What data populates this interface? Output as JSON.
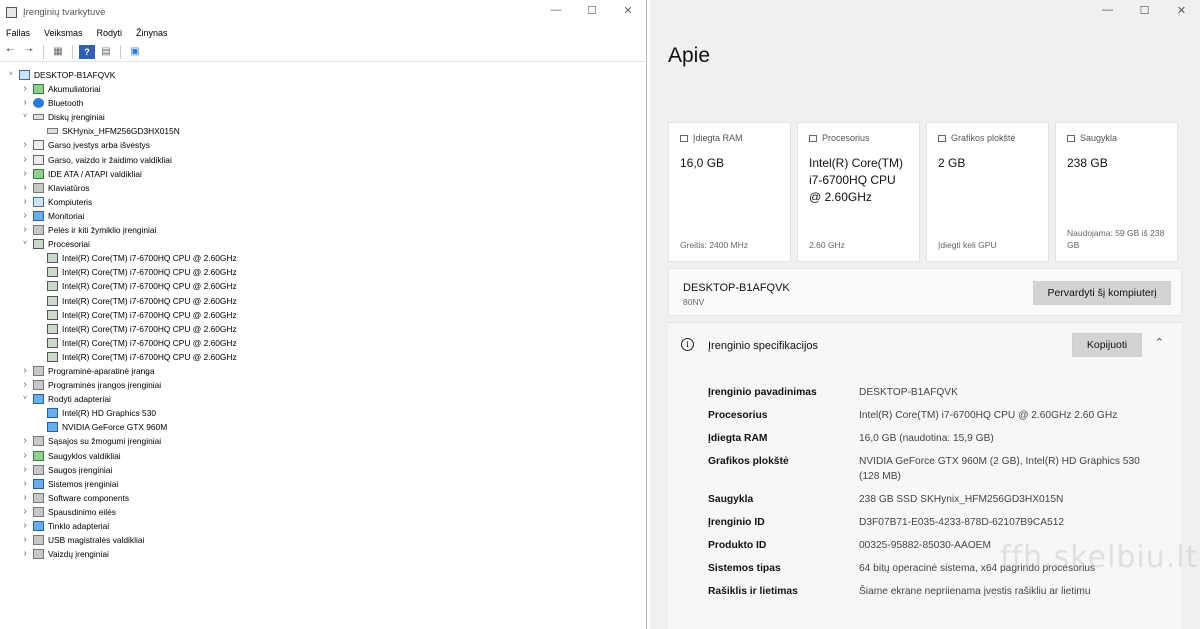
{
  "device_manager": {
    "title": "Įrenginių tvarkytuvė",
    "menu": [
      "Failas",
      "Veiksmas",
      "Rodyti",
      "Žinynas"
    ],
    "toolbar_icons": [
      "back-arrow-icon",
      "forward-arrow-icon",
      "properties-icon",
      "help-icon",
      "view-icon",
      "monitor-icon"
    ],
    "tree": [
      {
        "label": "DESKTOP-B1AFQVK",
        "level": 0,
        "state": "expanded",
        "icon": "computer-icon"
      },
      {
        "label": "Akumuliatoriai",
        "level": 1,
        "state": "collapsed",
        "icon": "battery-icon"
      },
      {
        "label": "Bluetooth",
        "level": 1,
        "state": "collapsed",
        "icon": "bluetooth-icon"
      },
      {
        "label": "Diskų įrenginiai",
        "level": 1,
        "state": "expanded",
        "icon": "disk-icon"
      },
      {
        "label": "SKHynix_HFM256GD3HX015N",
        "level": 2,
        "state": "leaf",
        "icon": "disk-icon"
      },
      {
        "label": "Garso įvestys arba išvestys",
        "level": 1,
        "state": "collapsed",
        "icon": "speaker-icon"
      },
      {
        "label": "Garso, vaizdo ir žaidimo valdikliai",
        "level": 1,
        "state": "collapsed",
        "icon": "speaker-icon"
      },
      {
        "label": "IDE ATA / ATAPI valdikliai",
        "level": 1,
        "state": "collapsed",
        "icon": "controller-icon"
      },
      {
        "label": "Klaviatūros",
        "level": 1,
        "state": "collapsed",
        "icon": "keyboard-icon"
      },
      {
        "label": "Kompiuteris",
        "level": 1,
        "state": "collapsed",
        "icon": "computer-icon"
      },
      {
        "label": "Monitoriai",
        "level": 1,
        "state": "collapsed",
        "icon": "monitor-icon"
      },
      {
        "label": "Pelės ir kiti žymiklio įrenginiai",
        "level": 1,
        "state": "collapsed",
        "icon": "mouse-icon"
      },
      {
        "label": "Procesoriai",
        "level": 1,
        "state": "expanded",
        "icon": "processor-icon"
      },
      {
        "label": "Intel(R) Core(TM) i7-6700HQ CPU @ 2.60GHz",
        "level": 2,
        "state": "leaf",
        "icon": "processor-icon"
      },
      {
        "label": "Intel(R) Core(TM) i7-6700HQ CPU @ 2.60GHz",
        "level": 2,
        "state": "leaf",
        "icon": "processor-icon"
      },
      {
        "label": "Intel(R) Core(TM) i7-6700HQ CPU @ 2.60GHz",
        "level": 2,
        "state": "leaf",
        "icon": "processor-icon"
      },
      {
        "label": "Intel(R) Core(TM) i7-6700HQ CPU @ 2.60GHz",
        "level": 2,
        "state": "leaf",
        "icon": "processor-icon"
      },
      {
        "label": "Intel(R) Core(TM) i7-6700HQ CPU @ 2.60GHz",
        "level": 2,
        "state": "leaf",
        "icon": "processor-icon"
      },
      {
        "label": "Intel(R) Core(TM) i7-6700HQ CPU @ 2.60GHz",
        "level": 2,
        "state": "leaf",
        "icon": "processor-icon"
      },
      {
        "label": "Intel(R) Core(TM) i7-6700HQ CPU @ 2.60GHz",
        "level": 2,
        "state": "leaf",
        "icon": "processor-icon"
      },
      {
        "label": "Intel(R) Core(TM) i7-6700HQ CPU @ 2.60GHz",
        "level": 2,
        "state": "leaf",
        "icon": "processor-icon"
      },
      {
        "label": "Programinė-aparatinė įranga",
        "level": 1,
        "state": "collapsed",
        "icon": "firmware-icon"
      },
      {
        "label": "Programinės įrangos įrenginiai",
        "level": 1,
        "state": "collapsed",
        "icon": "software-device-icon"
      },
      {
        "label": "Rodyti adapteriai",
        "level": 1,
        "state": "expanded",
        "icon": "display-adapter-icon"
      },
      {
        "label": "Intel(R) HD Graphics 530",
        "level": 2,
        "state": "leaf",
        "icon": "display-adapter-icon"
      },
      {
        "label": "NVIDIA GeForce GTX 960M",
        "level": 2,
        "state": "leaf",
        "icon": "display-adapter-icon"
      },
      {
        "label": "Sąsajos su žmogumi įrenginiai",
        "level": 1,
        "state": "collapsed",
        "icon": "hid-icon"
      },
      {
        "label": "Saugyklos valdikliai",
        "level": 1,
        "state": "collapsed",
        "icon": "storage-controller-icon"
      },
      {
        "label": "Saugos įrenginiai",
        "level": 1,
        "state": "collapsed",
        "icon": "security-device-icon"
      },
      {
        "label": "Sistemos įrenginiai",
        "level": 1,
        "state": "collapsed",
        "icon": "system-device-icon"
      },
      {
        "label": "Software components",
        "level": 1,
        "state": "collapsed",
        "icon": "software-component-icon"
      },
      {
        "label": "Spausdinimo eilės",
        "level": 1,
        "state": "collapsed",
        "icon": "printer-icon"
      },
      {
        "label": "Tinklo adapteriai",
        "level": 1,
        "state": "collapsed",
        "icon": "network-adapter-icon"
      },
      {
        "label": "USB magistralės valdikliai",
        "level": 1,
        "state": "collapsed",
        "icon": "usb-icon"
      },
      {
        "label": "Vaizdų įrenginiai",
        "level": 1,
        "state": "collapsed",
        "icon": "camera-icon"
      }
    ]
  },
  "about": {
    "title": "Apie",
    "cards": [
      {
        "label": "Įdiegta RAM",
        "value": "16,0 GB",
        "sub": "Greitis: 2400 MHz",
        "icon": "ram-icon"
      },
      {
        "label": "Procesorius",
        "value": "Intel(R) Core(TM) i7-6700HQ CPU @ 2.60GHz",
        "sub": "2.60 GHz",
        "icon": "cpu-icon"
      },
      {
        "label": "Grafikos plokštė",
        "value": "2 GB",
        "sub": "Įdiegti keli GPU",
        "icon": "gpu-icon"
      },
      {
        "label": "Saugykla",
        "value": "238 GB",
        "sub": "Naudojama: 59 GB iš 238 GB",
        "icon": "storage-icon"
      }
    ],
    "device": {
      "name": "DESKTOP-B1AFQVK",
      "model": "80NV",
      "rename_label": "Pervardyti šį kompiuterį"
    },
    "specs": {
      "title": "Įrenginio specifikacijos",
      "copy_label": "Kopijuoti",
      "rows": [
        {
          "key": "Įrenginio pavadinimas",
          "value": "DESKTOP-B1AFQVK"
        },
        {
          "key": "Procesorius",
          "value": "Intel(R) Core(TM) i7-6700HQ CPU @ 2.60GHz   2.60 GHz"
        },
        {
          "key": "Įdiegta RAM",
          "value": "16,0 GB (naudotina: 15,9 GB)"
        },
        {
          "key": "Grafikos plokštė",
          "value": "NVIDIA GeForce GTX 960M (2 GB), Intel(R) HD Graphics 530 (128 MB)"
        },
        {
          "key": "Saugykla",
          "value": "238 GB SSD SKHynix_HFM256GD3HX015N"
        },
        {
          "key": "Įrenginio ID",
          "value": "D3F07B71-E035-4233-878D-62107B9CA512"
        },
        {
          "key": "Produkto ID",
          "value": "00325-95882-85030-AAOEM"
        },
        {
          "key": "Sistemos tipas",
          "value": "64 bitų operacinė sistema, x64 pagrindo procesorius"
        },
        {
          "key": "Rašiklis ir lietimas",
          "value": "Šiame ekrane nepriienama įvestis rašikliu ar lietimu"
        }
      ]
    },
    "watermark": "ffh.skelbiu.lt"
  }
}
